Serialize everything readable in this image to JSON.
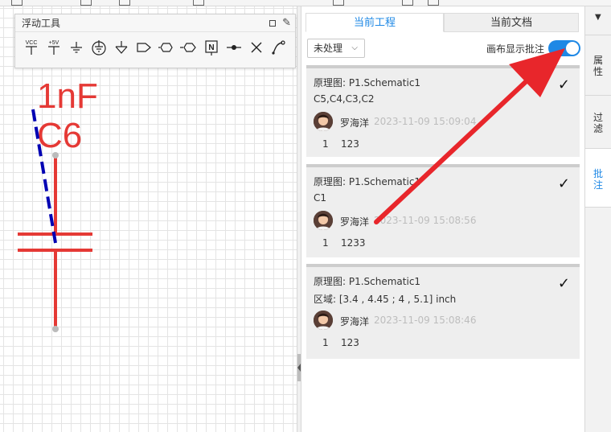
{
  "floating_tools": {
    "title": "浮动工具",
    "tools": [
      {
        "name": "vcc-icon",
        "label": "VCC"
      },
      {
        "name": "plus-5v-icon",
        "label": "+5V"
      },
      {
        "name": "ground-icon",
        "label": ""
      },
      {
        "name": "earth-ground-icon",
        "label": ""
      },
      {
        "name": "signal-ground-icon",
        "label": ""
      },
      {
        "name": "net-port-output-icon",
        "label": ""
      },
      {
        "name": "net-port-bidirectional-icon",
        "label": ""
      },
      {
        "name": "net-port-input-icon",
        "label": ""
      },
      {
        "name": "net-label-icon",
        "label": "N"
      },
      {
        "name": "junction-icon",
        "label": ""
      },
      {
        "name": "no-connect-icon",
        "label": ""
      },
      {
        "name": "wire-tool-icon",
        "label": ""
      }
    ]
  },
  "schematic": {
    "value_label": "1nF",
    "designator": "C6",
    "component_color": "#e53935",
    "annotation_color": "#0000b3"
  },
  "panel": {
    "tabs": [
      "当前工程",
      "当前文档"
    ],
    "active_tab": "当前工程",
    "filter_value": "未处理",
    "toggle_label": "画布显示批注",
    "toggle_on": true,
    "accent": "#1e88e5"
  },
  "notes": [
    {
      "source": "原理图: P1.Schematic1",
      "target": "C5,C4,C3,C2",
      "author": "罗海洋",
      "time": "2023-11-09 15:09:04",
      "count": "1",
      "message": "123",
      "resolved": "✓"
    },
    {
      "source": "原理图: P1.Schematic1",
      "target": "C1",
      "author": "罗海洋",
      "time": "2023-11-09 15:08:56",
      "count": "1",
      "message": "1233",
      "resolved": "✓"
    },
    {
      "source": "原理图: P1.Schematic1",
      "target": "区域: [3.4 , 4.45 ; 4 , 5.1] inch",
      "author": "罗海洋",
      "time": "2023-11-09 15:08:46",
      "count": "1",
      "message": "123",
      "resolved": "✓"
    }
  ],
  "side_tabs": [
    "属性",
    "过滤",
    "批注"
  ],
  "active_side_tab": "批注",
  "pin_icon": "pin-icon",
  "arrow_color": "#e8262b"
}
